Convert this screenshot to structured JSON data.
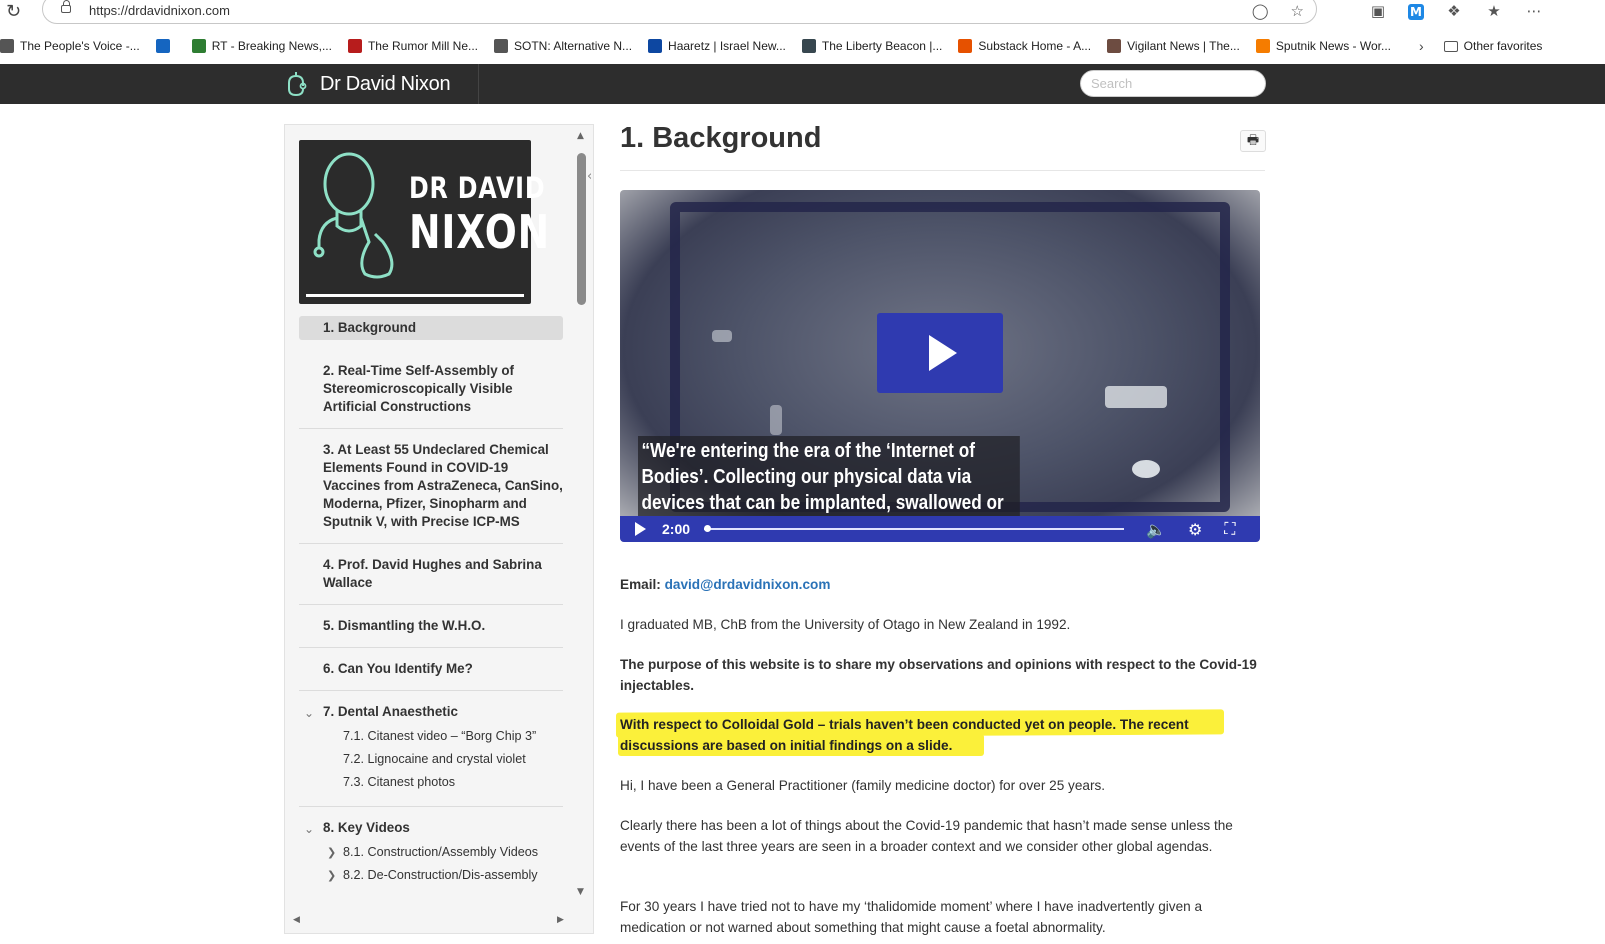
{
  "browser": {
    "url": "https://drdavidnixon.com",
    "bookmarks": [
      {
        "label": "The People's Voice -...",
        "icon_color": "#555555"
      },
      {
        "label": "",
        "icon_color": "#1565c0",
        "icon": "search-icon"
      },
      {
        "label": "RT - Breaking News,...",
        "icon_color": "#2e7d32"
      },
      {
        "label": "The Rumor Mill Ne...",
        "icon_color": "#b71c1c"
      },
      {
        "label": "SOTN: Alternative N...",
        "icon_color": "#555555"
      },
      {
        "label": "Haaretz | Israel New...",
        "icon_color": "#0d47a1"
      },
      {
        "label": "The Liberty Beacon |...",
        "icon_color": "#37474f"
      },
      {
        "label": "Substack Home - A...",
        "icon_color": "#e65100"
      },
      {
        "label": "Vigilant News | The...",
        "icon_color": "#6d4c41"
      },
      {
        "label": "Sputnik News - Wor...",
        "icon_color": "#f57c00"
      }
    ],
    "other_favorites": "Other favorites"
  },
  "site": {
    "brand": "Dr David Nixon",
    "search_placeholder": "Search",
    "logo_line1": "DR DAVID",
    "logo_line2": "NIXON"
  },
  "sidebar": {
    "active": "1. Background",
    "items": [
      "2. Real-Time Self-Assembly of Stereomicroscopically Visible Artificial Constructions",
      "3. At Least 55 Undeclared Chemical Elements Found in COVID-19 Vaccines from AstraZeneca, CanSino, Moderna, Pfizer, Sinopharm and Sputnik V, with Precise ICP-MS",
      "4. Prof. David Hughes and Sabrina Wallace",
      "5. Dismantling the W.H.O.",
      "6. Can You Identify Me?"
    ],
    "dental": {
      "label": "7. Dental Anaesthetic",
      "subs": [
        "7.1. Citanest video – “Borg Chip 3”",
        "7.2. Lignocaine and crystal violet",
        "7.3. Citanest photos"
      ]
    },
    "key_videos": {
      "label": "8. Key Videos",
      "subs": [
        "8.1. Construction/Assembly Videos",
        "8.2. De-Construction/Dis-assembly"
      ]
    }
  },
  "main": {
    "title": "1. Background",
    "video": {
      "caption": "“We're entering the era of the ‘Internet of Bodies’. Collecting our physical data via devices that can be implanted, swallowed or worn.” ~ Xiao Liu , WEF",
      "time": "2:00",
      "progress": 0.0
    },
    "email_label": "Email:",
    "email": "david@drdavidnixon.com",
    "p1": "I graduated MB, ChB from the University of Otago in New Zealand in 1992.",
    "p2": "The purpose of this website is to share my observations and opinions with respect to the Covid-19 injectables.",
    "p3": "With respect to Colloidal Gold – trials haven’t been conducted yet on people. The recent discussions are based on initial findings on a slide.",
    "p4": "Hi, I have been a General Practitioner (family medicine doctor) for over 25 years.",
    "p5": "Clearly there has been a lot of things about the Covid-19 pandemic that hasn’t made sense unless the events of the last three years are seen in a broader context and we consider other global agendas.",
    "p6": "For 30 years I have tried not to have my ‘thalidomide moment’ where I have inadvertently given a medication or not warned about something that might cause a foetal abnormality."
  }
}
